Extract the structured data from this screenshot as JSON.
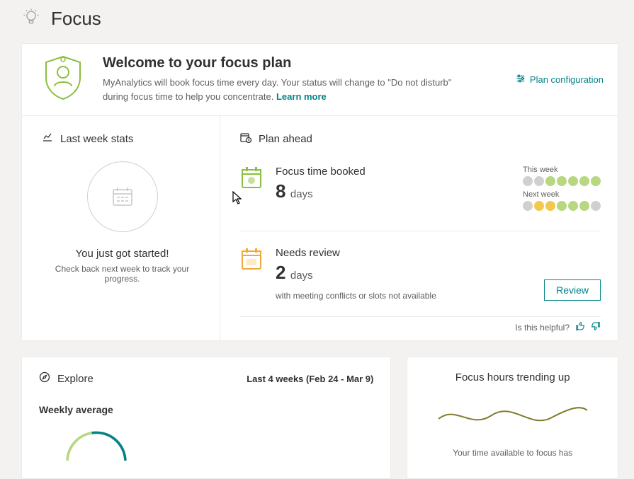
{
  "header": {
    "title": "Focus"
  },
  "welcome": {
    "title": "Welcome to your focus plan",
    "desc": "MyAnalytics will book focus time every day. Your status will change to \"Do not disturb\" during focus time to help you concentrate. ",
    "learn_more": "Learn more",
    "plan_config": "Plan configuration"
  },
  "last_week": {
    "heading": "Last week stats",
    "msg": "You just got started!",
    "sub": "Check back next week to track your progress."
  },
  "plan_ahead": {
    "heading": "Plan ahead",
    "booked": {
      "title": "Focus time booked",
      "value": "8",
      "unit": "days",
      "this_week_label": "This week",
      "next_week_label": "Next week"
    },
    "review": {
      "title": "Needs review",
      "value": "2",
      "unit": "days",
      "note": "with meeting conflicts or slots not available",
      "button": "Review"
    },
    "helpful": "Is this helpful?"
  },
  "explore": {
    "heading": "Explore",
    "range": "Last 4 weeks (Feb 24 - Mar 9)",
    "weekly": "Weekly average"
  },
  "trend": {
    "title": "Focus hours trending up",
    "note": "Your time available to focus has"
  },
  "chart_data": [
    {
      "type": "dots",
      "name": "this_week",
      "values": [
        "grey",
        "grey",
        "green",
        "green",
        "green",
        "green",
        "green"
      ]
    },
    {
      "type": "dots",
      "name": "next_week",
      "values": [
        "grey",
        "yellow",
        "yellow",
        "green",
        "green",
        "green",
        "grey"
      ]
    },
    {
      "type": "pie",
      "name": "weekly_average_arc",
      "values": [
        35,
        65
      ],
      "colors": [
        "#038387",
        "#b7d780"
      ],
      "partial": true
    },
    {
      "type": "line",
      "name": "trend_sparkline",
      "x": [
        0,
        0.25,
        0.5,
        0.75,
        1.0
      ],
      "values": [
        0.55,
        0.35,
        0.7,
        0.4,
        0.75
      ]
    }
  ]
}
